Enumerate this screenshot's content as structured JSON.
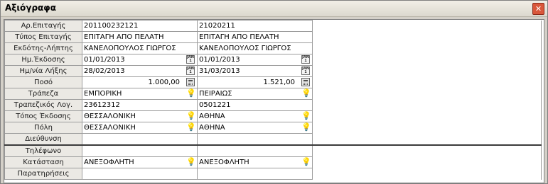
{
  "window": {
    "title": "Αξιόγραφα",
    "close_symbol": "✕"
  },
  "fields": {
    "number": {
      "label": "Αρ.Επιταγής",
      "values": [
        "201100232121",
        "21020211"
      ]
    },
    "type": {
      "label": "Τύπος Επιταγής",
      "values": [
        "ΕΠΙΤΑΓΗ ΑΠΟ ΠΕΛΑΤΗ",
        "ΕΠΙΤΑΓΗ ΑΠΟ ΠΕΛΑΤΗ"
      ]
    },
    "issuer": {
      "label": "Εκδότης-Λήπτης",
      "values": [
        "ΚΑΝΕΛΟΠΟΥΛΟΣ ΓΙΩΡΓΟΣ",
        "ΚΑΝΕΛΟΠΟΥΛΟΣ ΓΙΩΡΓΟΣ"
      ]
    },
    "issue_date": {
      "label": "Ημ.Έκδοσης",
      "values": [
        "01/01/2013",
        "01/01/2013"
      ]
    },
    "expiry_date": {
      "label": "Ημ/νία Λήξης",
      "values": [
        "28/02/2013",
        "31/03/2013"
      ]
    },
    "amount": {
      "label": "Ποσό",
      "values": [
        "1.000,00",
        "1.521,00"
      ]
    },
    "bank": {
      "label": "Τράπεζα",
      "values": [
        "ΕΜΠΟΡΙΚΗ",
        "ΠΕΙΡΑΙΩΣ"
      ]
    },
    "bank_account": {
      "label": "Τραπεζικός Λογ.",
      "values": [
        "23612312",
        "0501221"
      ]
    },
    "issue_place": {
      "label": "Τόπος Έκδοσης",
      "values": [
        "ΘΕΣΣΑΛΟΝΙΚΗ",
        "ΑΘΗΝΑ"
      ]
    },
    "city": {
      "label": "Πόλη",
      "values": [
        "ΘΕΣΣΑΛΟΝΙΚΗ",
        "ΑΘΗΝΑ"
      ]
    },
    "address": {
      "label": "Διεύθυνση",
      "values": [
        "",
        ""
      ]
    },
    "phone": {
      "label": "Τηλέφωνο",
      "values": [
        "",
        ""
      ]
    },
    "status": {
      "label": "Κατάσταση",
      "values": [
        "ΑΝΕΞΟΦΛΗΤΗ",
        "ΑΝΕΞΟΦΛΗΤΗ"
      ]
    },
    "notes": {
      "label": "Παρατηρήσεις",
      "values": [
        "",
        ""
      ]
    }
  },
  "icons": {
    "calendar": "calendar-icon",
    "calculator": "calculator-icon",
    "lookup": "lookup-bulb-icon"
  },
  "calendar_icon_text": "JAN\n1"
}
